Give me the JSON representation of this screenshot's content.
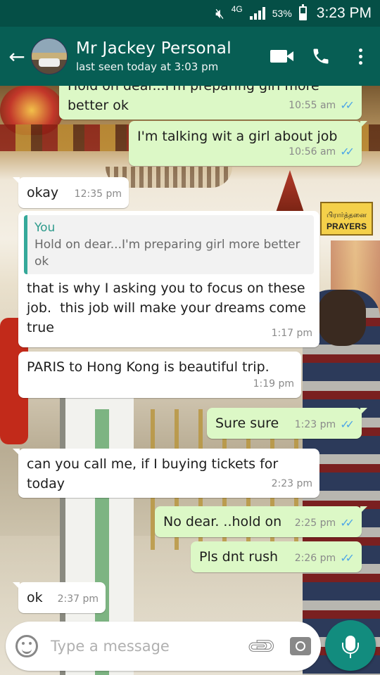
{
  "status_bar": {
    "network": "4G",
    "battery_percent": "53%",
    "battery_level": 0.53,
    "time": "3:23 PM"
  },
  "header": {
    "contact_name": "Mr Jackey Personal",
    "last_seen": "last seen today at 3:03 pm"
  },
  "wallpaper": {
    "sign_text": "PRAYERS",
    "sign_text_tamil": "பிரார்த்தனை"
  },
  "messages": [
    {
      "direction": "out",
      "text": "Hold on dear...I'm preparing girl more better ok",
      "time": "10:55 am",
      "read": true
    },
    {
      "direction": "out",
      "text": "I'm talking wit a girl about job",
      "time": "10:56 am",
      "read": true
    },
    {
      "direction": "in",
      "text": "okay",
      "time": "12:35 pm"
    },
    {
      "direction": "in",
      "quote_author": "You",
      "quote_text": "Hold on dear...I'm preparing girl more better ok",
      "text": "that is why I asking you to focus on these job.  this job will make your dreams come true",
      "time": "1:17 pm"
    },
    {
      "direction": "in",
      "text": "PARIS to Hong Kong is beautiful trip.",
      "time": "1:19 pm"
    },
    {
      "direction": "out",
      "text": "Sure sure",
      "time": "1:23 pm",
      "read": true
    },
    {
      "direction": "in",
      "text": "can you call me, if I buying tickets for today",
      "time": "2:23 pm"
    },
    {
      "direction": "out",
      "text": "No dear. ..hold on",
      "time": "2:25 pm",
      "read": true
    },
    {
      "direction": "out",
      "text": "Pls dnt rush",
      "time": "2:26 pm",
      "read": true
    },
    {
      "direction": "in",
      "text": "ok",
      "time": "2:37 pm"
    }
  ],
  "composer": {
    "placeholder": "Type a message"
  },
  "icons": [
    "mute-icon",
    "signal-icon",
    "battery-icon",
    "back-arrow-icon",
    "video-call-icon",
    "phone-icon",
    "more-options-icon",
    "read-receipt-icon",
    "emoji-icon",
    "attach-icon",
    "camera-icon",
    "mic-icon"
  ],
  "colors": {
    "status_bar": "#054f46",
    "header": "#075e54",
    "outgoing_bubble": "#dcf8c6",
    "incoming_bubble": "#ffffff",
    "read_ticks": "#4fa7e6",
    "mic_button": "#128c7e"
  }
}
